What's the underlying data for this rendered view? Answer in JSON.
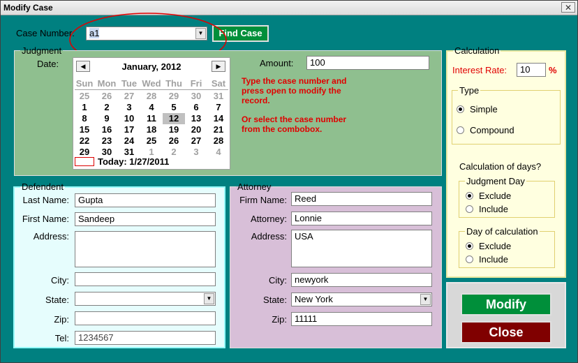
{
  "window": {
    "title": "Modify Case",
    "close_glyph": "✕"
  },
  "case_number": {
    "label": "Case Number:",
    "value": "a1",
    "find_label": "Find Case"
  },
  "judgment": {
    "legend": "Judgment",
    "date_label": "Date:",
    "amount_label": "Amount:",
    "amount_value": "100",
    "calendar": {
      "month_title": "January, 2012",
      "prev_glyph": "◀",
      "next_glyph": "▶",
      "dow": [
        "Sun",
        "Mon",
        "Tue",
        "Wed",
        "Thu",
        "Fri",
        "Sat"
      ],
      "weeks": [
        [
          "25",
          "26",
          "27",
          "28",
          "29",
          "30",
          "31"
        ],
        [
          "1",
          "2",
          "3",
          "4",
          "5",
          "6",
          "7"
        ],
        [
          "8",
          "9",
          "10",
          "11",
          "12",
          "13",
          "14"
        ],
        [
          "15",
          "16",
          "17",
          "18",
          "19",
          "20",
          "21"
        ],
        [
          "22",
          "23",
          "24",
          "25",
          "26",
          "27",
          "28"
        ],
        [
          "29",
          "30",
          "31",
          "1",
          "2",
          "3",
          "4"
        ]
      ],
      "selected_day": "12",
      "today_text": "Today: 1/27/2011"
    },
    "hint_line1": "Type the case number and",
    "hint_line2": "press open to modify the",
    "hint_line3": "record.",
    "hint_line4": "Or select the case number",
    "hint_line5": "from the combobox."
  },
  "defendent": {
    "legend": "Defendent",
    "last_name_label": "Last Name:",
    "last_name": "Gupta",
    "first_name_label": "First Name:",
    "first_name": "Sandeep",
    "address_label": "Address:",
    "address": "",
    "city_label": "City:",
    "city": "",
    "state_label": "State:",
    "state": "",
    "zip_label": "Zip:",
    "zip": "",
    "tel_label": "Tel:",
    "tel": "1234567"
  },
  "attorney": {
    "legend": "Attorney",
    "firm_label": "Firm Name:",
    "firm": "Reed",
    "attorney_label": "Attorney:",
    "attorney": "Lonnie",
    "address_label": "Address:",
    "address": "USA",
    "city_label": "City:",
    "city": "newyork",
    "state_label": "State:",
    "state": "New York",
    "zip_label": "Zip:",
    "zip": "11111"
  },
  "calculation": {
    "legend": "Calculation",
    "interest_label": "Interest Rate:",
    "interest_value": "10",
    "percent": "%",
    "type_legend": "Type",
    "simple": "Simple",
    "compound": "Compound",
    "days_title": "Calculation of days?",
    "judgment_day_legend": "Judgment Day",
    "day_calc_legend": "Day of calculation",
    "exclude": "Exclude",
    "include": "Include"
  },
  "actions": {
    "modify": "Modify",
    "close": "Close"
  },
  "colors": {
    "background": "#008080",
    "judgment_panel": "#8fbf8f",
    "defendent_panel": "#e6fdfd",
    "attorney_panel": "#d8bfd8",
    "calc_panel": "#ffffe0",
    "modify_button": "#008f3a",
    "close_button": "#800000",
    "hint_text": "#e00000"
  }
}
